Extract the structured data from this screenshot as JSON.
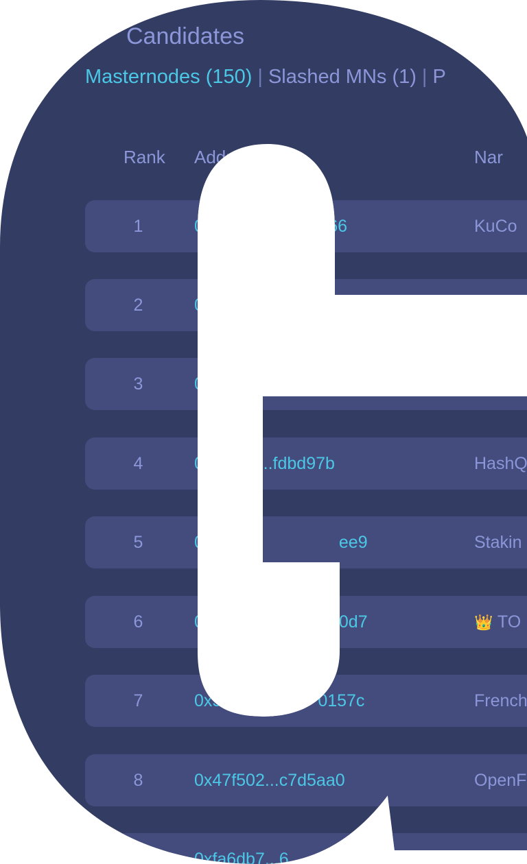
{
  "page": {
    "title": "Candidates"
  },
  "tabs": [
    {
      "label": "Masternodes (150)",
      "active": true
    },
    {
      "label": "Slashed MNs (1)",
      "active": false
    },
    {
      "label": "P",
      "active": false
    }
  ],
  "tab_separator": "|",
  "table": {
    "headers": {
      "rank": "Rank",
      "address": "Addre",
      "name": "Nar"
    },
    "rows": [
      {
        "rank": "1",
        "address": "0x",
        "address_tail": "fe66",
        "name": "KuCo"
      },
      {
        "rank": "2",
        "address": "0",
        "address_tail": "",
        "name": ""
      },
      {
        "rank": "3",
        "address": "0",
        "address_tail": "",
        "name": ""
      },
      {
        "rank": "4",
        "address": "0",
        "address_tail": "eb...fdbd97b",
        "name": "HashQ"
      },
      {
        "rank": "5",
        "address": "0",
        "address_tail": "ee9",
        "name": "Stakin"
      },
      {
        "rank": "6",
        "address": "0",
        "address_tail": "0d7",
        "name": "TO",
        "crown": "👑"
      },
      {
        "rank": "7",
        "address": "0x5",
        "address_tail": "0157c",
        "name": "French"
      },
      {
        "rank": "8",
        "address": "0x47f502...c7d5aa0",
        "address_tail": "",
        "name": "OpenF"
      },
      {
        "rank": "",
        "address": "0xfa6db7...6",
        "address_tail": "",
        "name": ""
      }
    ]
  },
  "colors": {
    "background": "#333d63",
    "row": "#434c7c",
    "accent": "#4cc7e6",
    "muted": "#8c96d8",
    "outside": "#ffffff"
  }
}
